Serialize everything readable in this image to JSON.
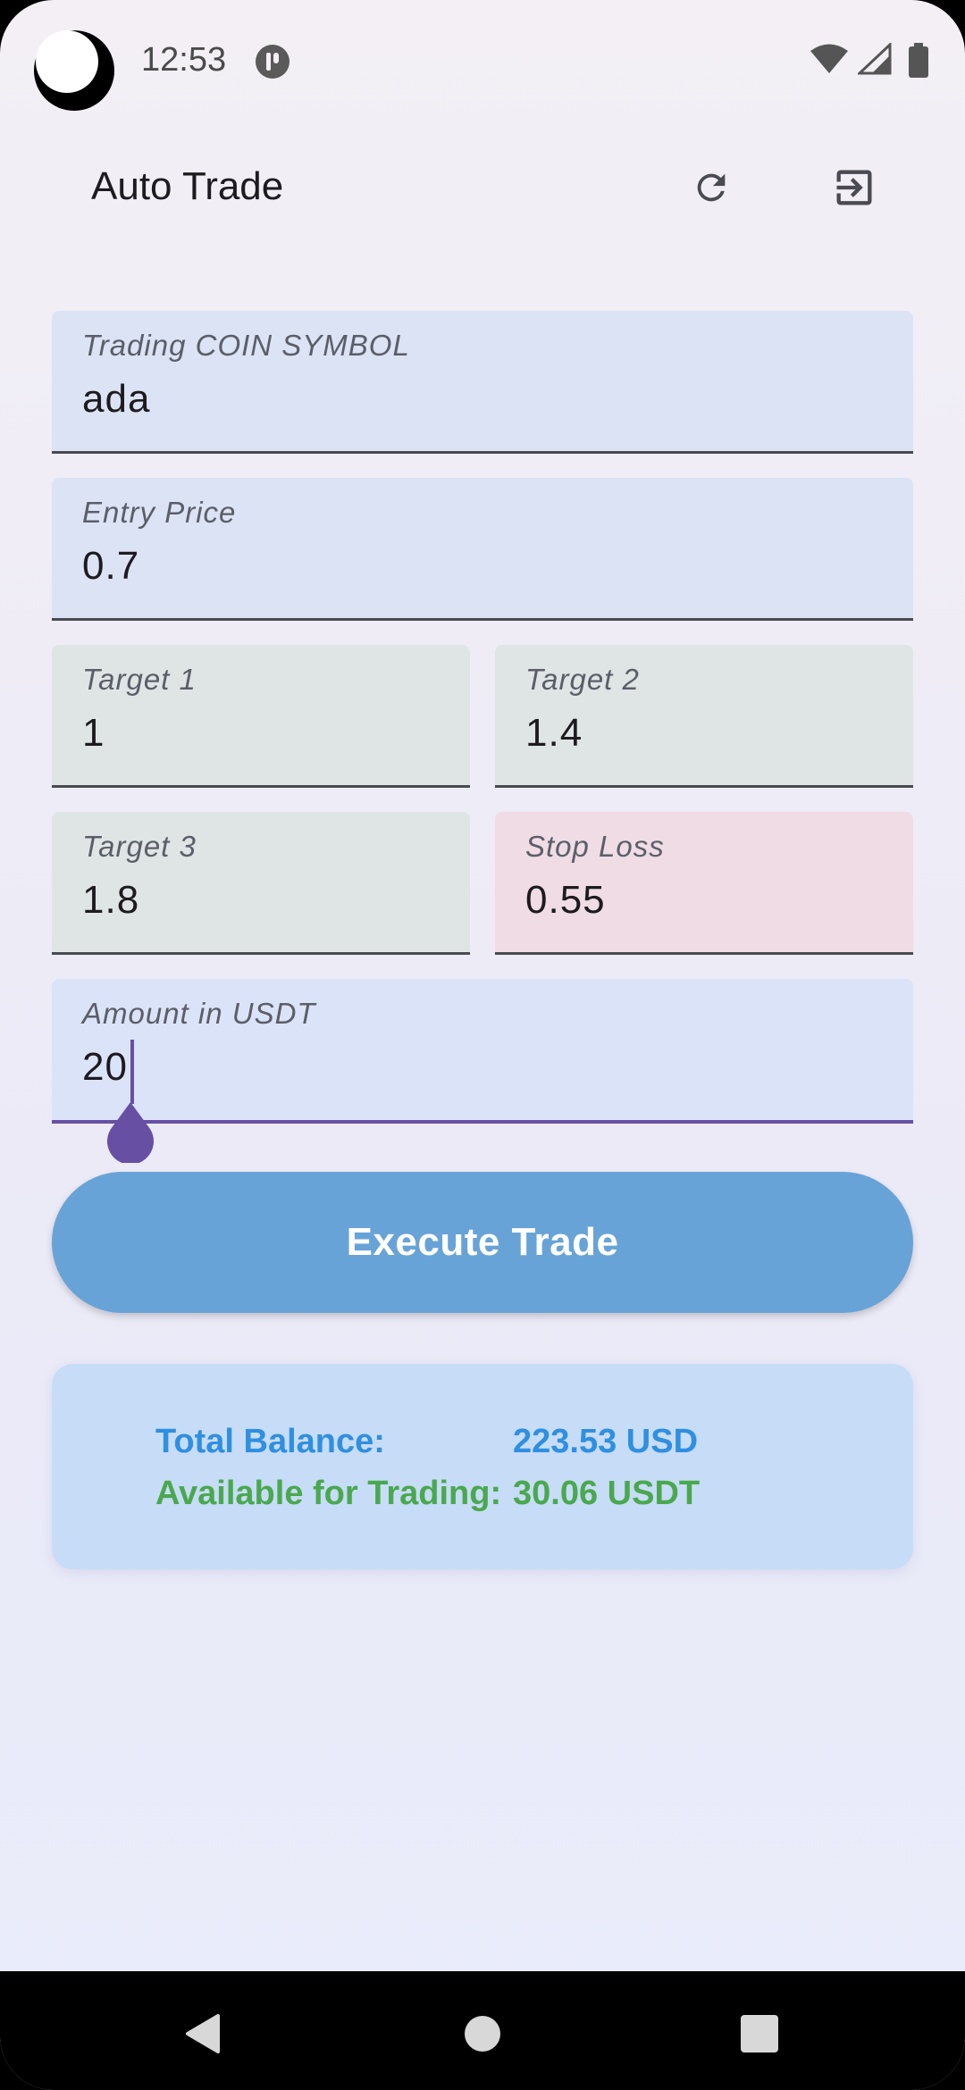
{
  "status_bar": {
    "time": "12:53"
  },
  "app_bar": {
    "title": "Auto Trade",
    "refresh_icon": "refresh-icon",
    "logout_icon": "logout-icon"
  },
  "form": {
    "coin_symbol": {
      "label": "Trading COIN SYMBOL",
      "value": "ada"
    },
    "entry_price": {
      "label": "Entry Price",
      "value": "0.7"
    },
    "target1": {
      "label": "Target 1",
      "value": "1"
    },
    "target2": {
      "label": "Target 2",
      "value": "1.4"
    },
    "target3": {
      "label": "Target 3",
      "value": "1.8"
    },
    "stop_loss": {
      "label": "Stop Loss",
      "value": "0.55"
    },
    "amount": {
      "label": "Amount in USDT",
      "value": "20"
    }
  },
  "execute_button": {
    "label": "Execute Trade"
  },
  "balance": {
    "total_label": "Total Balance:",
    "total_value": "223.53 USD",
    "available_label": "Available for Trading:",
    "available_value": "30.06 USDT"
  },
  "colors": {
    "accent": "#6750a4",
    "button": "#68a3d7",
    "total": "#2f8fe0",
    "available": "#4aa84f",
    "stop_loss_bg": "#efdce4"
  }
}
